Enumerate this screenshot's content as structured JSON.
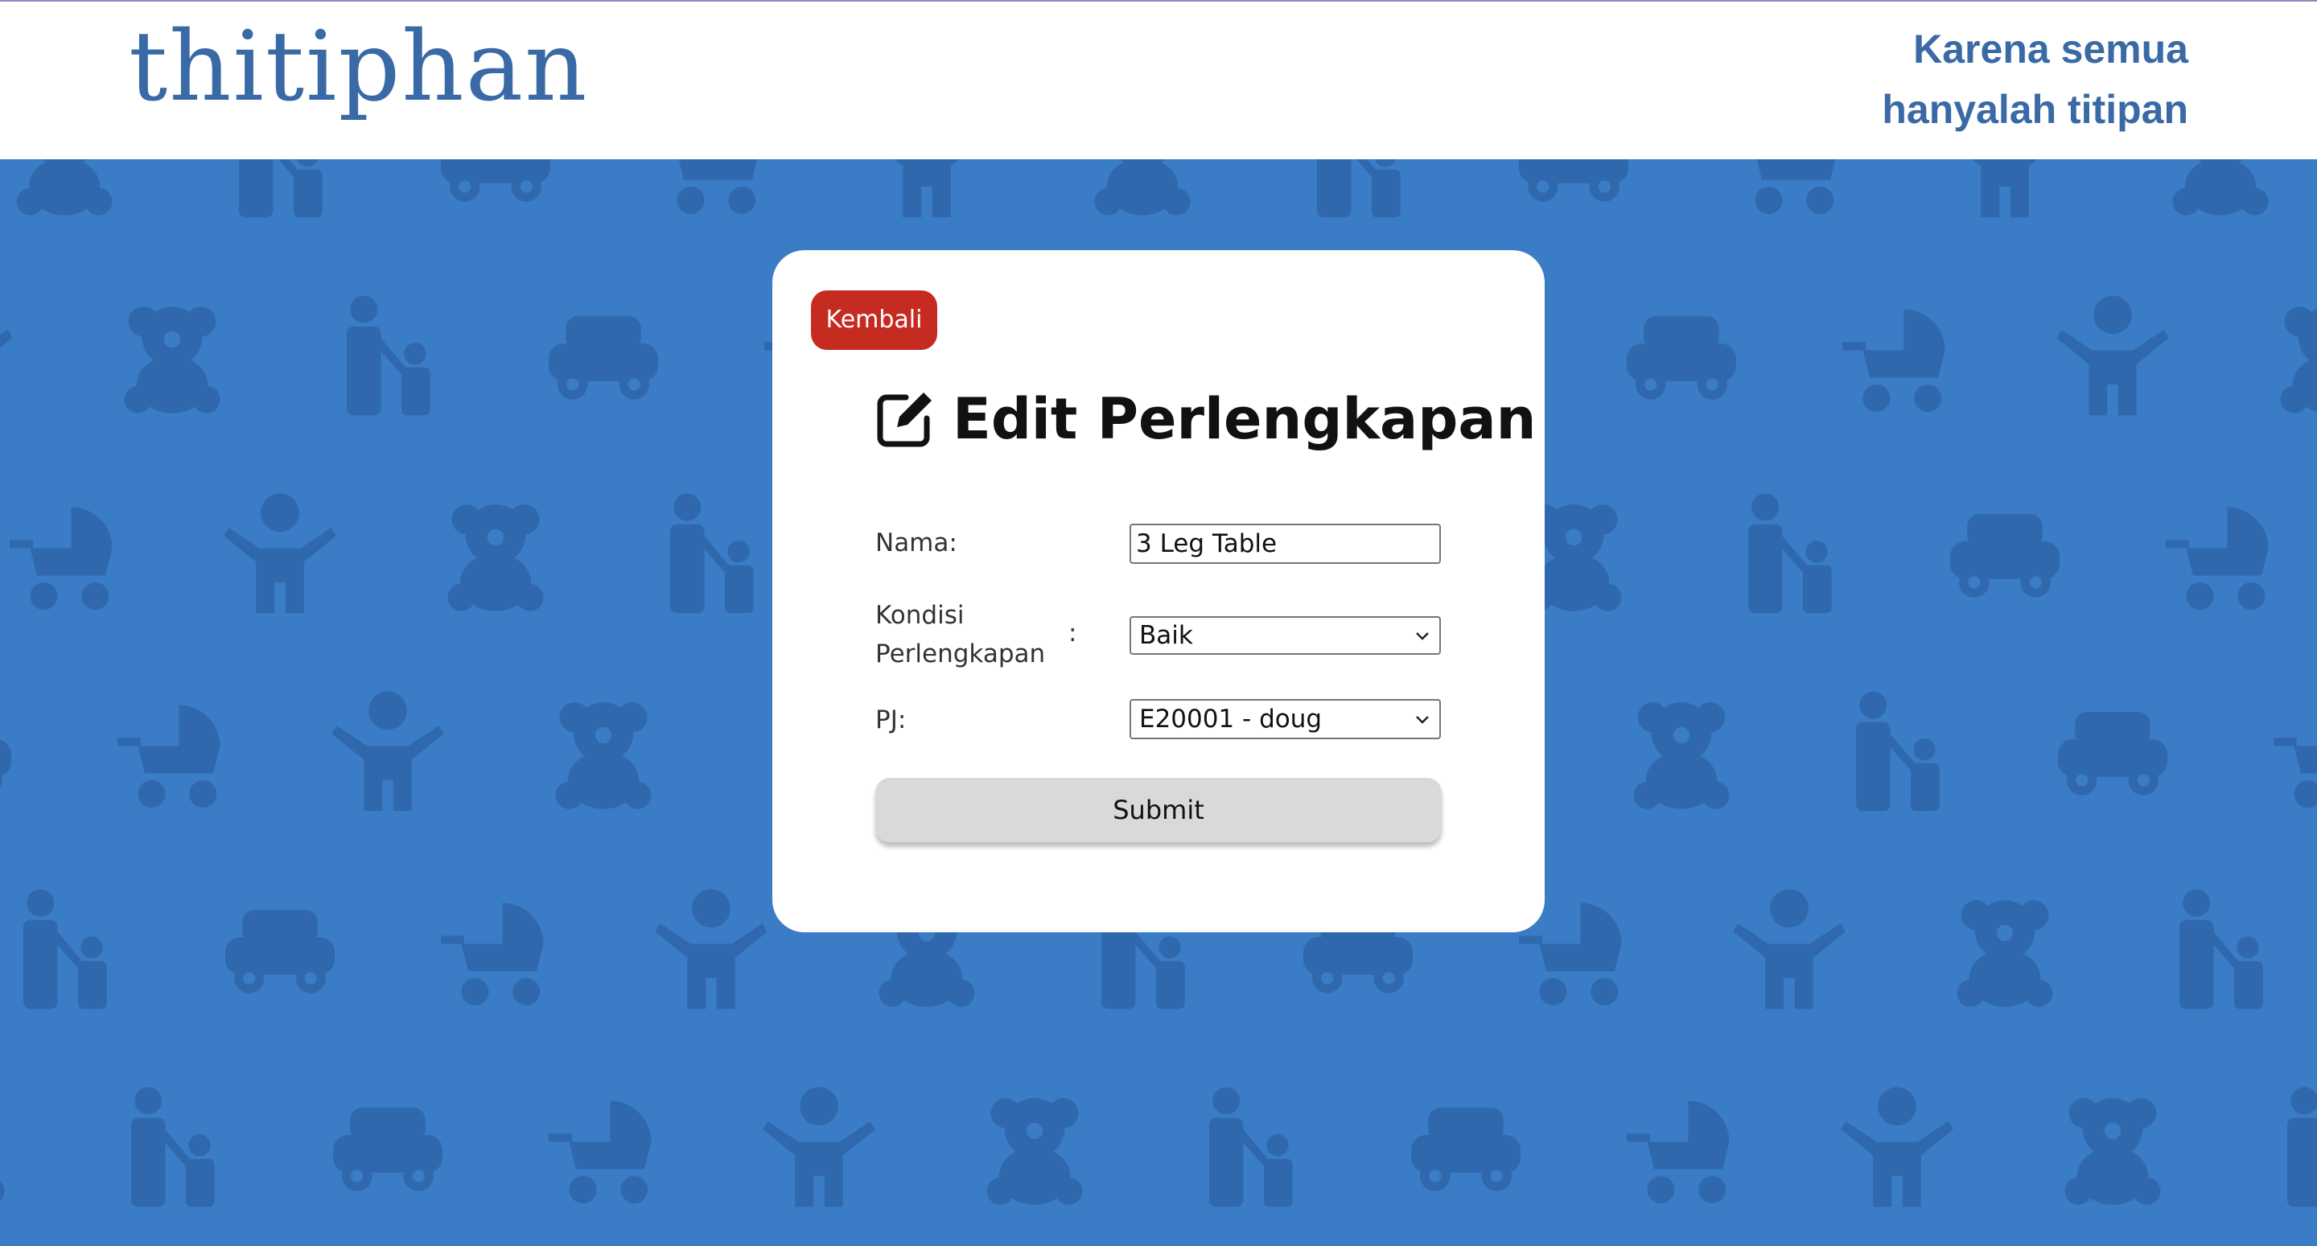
{
  "header": {
    "logo": "thitiphan",
    "tagline_line1": "Karena semua",
    "tagline_line2": "hanyalah titipan"
  },
  "card": {
    "back_label": "Kembali",
    "title": "Edit Perlengkapan",
    "form": {
      "nama_label": "Nama:",
      "nama_value": "3 Leg Table",
      "kondisi_label_line1": "Kondisi",
      "kondisi_label_line2": "Perlengkapan",
      "kondisi_colon": ":",
      "kondisi_value": "Baik",
      "pj_label": "PJ:",
      "pj_value": "E20001 - doug",
      "submit_label": "Submit"
    }
  },
  "colors": {
    "background": "#3b7cc6",
    "pattern_icon": "#2f68ad",
    "brand": "#3a6aa6",
    "back_button": "#c62b22",
    "submit_button": "#d9d9d9"
  },
  "icons": {
    "title_icon": "edit-icon",
    "pattern_icons": [
      "teddy-bear-icon",
      "stroller-icon",
      "parent-child-icon",
      "child-icon",
      "toy-car-icon"
    ]
  }
}
